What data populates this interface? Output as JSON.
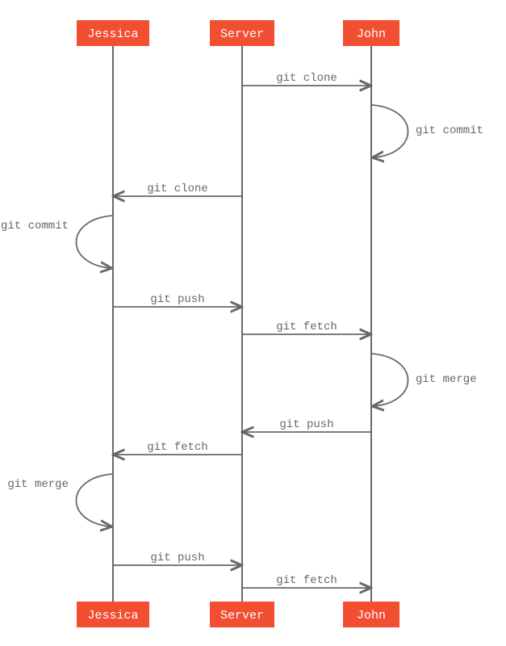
{
  "diagram": {
    "actors": [
      "Jessica",
      "Server",
      "John"
    ],
    "messages": [
      {
        "label": "git clone",
        "from": "Server",
        "to": "John",
        "type": "arrow"
      },
      {
        "label": "git commit",
        "from": "John",
        "to": "John",
        "type": "self-right"
      },
      {
        "label": "git clone",
        "from": "Server",
        "to": "Jessica",
        "type": "arrow"
      },
      {
        "label": "git commit",
        "from": "Jessica",
        "to": "Jessica",
        "type": "self-left"
      },
      {
        "label": "git push",
        "from": "Jessica",
        "to": "Server",
        "type": "arrow"
      },
      {
        "label": "git fetch",
        "from": "Server",
        "to": "John",
        "type": "arrow"
      },
      {
        "label": "git merge",
        "from": "John",
        "to": "John",
        "type": "self-right"
      },
      {
        "label": "git push",
        "from": "John",
        "to": "Server",
        "type": "arrow"
      },
      {
        "label": "git fetch",
        "from": "Server",
        "to": "Jessica",
        "type": "arrow"
      },
      {
        "label": "git merge",
        "from": "Jessica",
        "to": "Jessica",
        "type": "self-left"
      },
      {
        "label": "git push",
        "from": "Jessica",
        "to": "Server",
        "type": "arrow"
      },
      {
        "label": "git fetch",
        "from": "Server",
        "to": "John",
        "type": "arrow"
      }
    ]
  }
}
